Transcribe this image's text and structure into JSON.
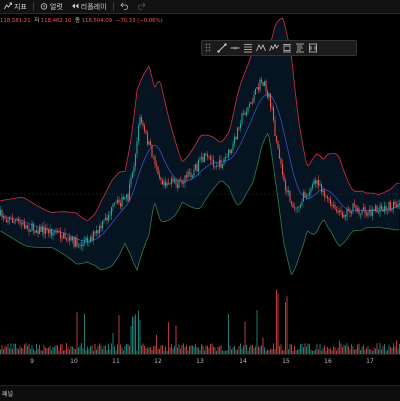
{
  "toolbar": {
    "indicators_label": "지표",
    "alerts_label": "얼럿",
    "replay_label": "리플레이"
  },
  "ohlc": {
    "open_suffix": "118,581.21",
    "low_prefix": "저",
    "low_value": "118,462.10",
    "close_prefix": "종",
    "close_value": "118,504.09",
    "change": "−70.33 (−0.06%)"
  },
  "drawing_tools": [
    "trend-line-icon",
    "horizontal-line-icon",
    "fib-retracement-icon",
    "pattern-icon",
    "elliott-wave-icon",
    "long-position-icon",
    "date-range-icon",
    "price-range-icon"
  ],
  "x_axis": {
    "labels": [
      "9",
      "10",
      "11",
      "12",
      "13",
      "14",
      "15",
      "16",
      "17"
    ]
  },
  "bottom_panel": {
    "label": "패널"
  },
  "colors": {
    "up": "#26a69a",
    "down": "#ef5350",
    "upper_band": "#d32f3f",
    "lower_band": "#2e7d4f",
    "basis": "#3a5bd8"
  }
}
